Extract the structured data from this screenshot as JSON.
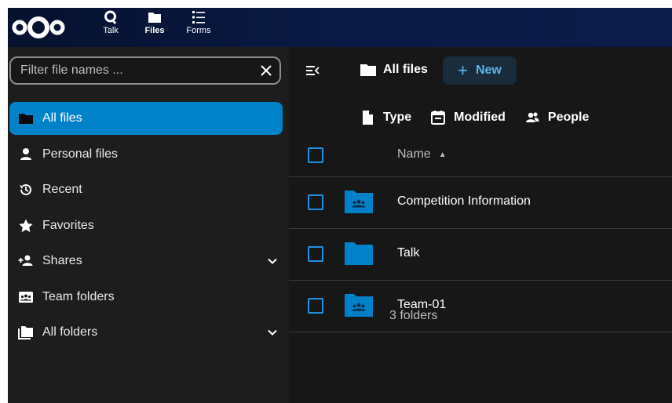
{
  "colors": {
    "accent": "#0082c9",
    "header_bg": "#0a1a44",
    "sidebar_bg": "#1d1d1d",
    "main_bg": "#171717",
    "checkbox": "#1e90e0",
    "new_button_text": "#5fb4ee"
  },
  "header": {
    "logo_icon": "nextcloud-logo-icon",
    "apps": [
      {
        "label": "Talk",
        "icon": "search-icon"
      },
      {
        "label": "Files",
        "icon": "folder-icon"
      },
      {
        "label": "Forms",
        "icon": "list-icon"
      }
    ]
  },
  "sidebar": {
    "filter_placeholder": "Filter file names ...",
    "items": [
      {
        "label": "All files",
        "icon": "folder-icon",
        "active": true
      },
      {
        "label": "Personal files",
        "icon": "person-icon"
      },
      {
        "label": "Recent",
        "icon": "history-icon"
      },
      {
        "label": "Favorites",
        "icon": "star-icon"
      },
      {
        "label": "Shares",
        "icon": "share-person-icon",
        "expandable": true
      },
      {
        "label": "Team folders",
        "icon": "team-folder-icon"
      },
      {
        "label": "All folders",
        "icon": "folders-icon",
        "expandable": true
      }
    ]
  },
  "main": {
    "breadcrumb": "All files",
    "new_button": "New",
    "filters": [
      {
        "label": "Type",
        "icon": "file-icon"
      },
      {
        "label": "Modified",
        "icon": "calendar-icon"
      },
      {
        "label": "People",
        "icon": "people-icon"
      }
    ],
    "table": {
      "name_header": "Name",
      "rows": [
        {
          "name": "Competition Information",
          "icon": "team-folder-icon"
        },
        {
          "name": "Talk",
          "icon": "folder-icon"
        },
        {
          "name": "Team-01",
          "icon": "team-folder-icon"
        }
      ],
      "summary": "3 folders"
    }
  }
}
